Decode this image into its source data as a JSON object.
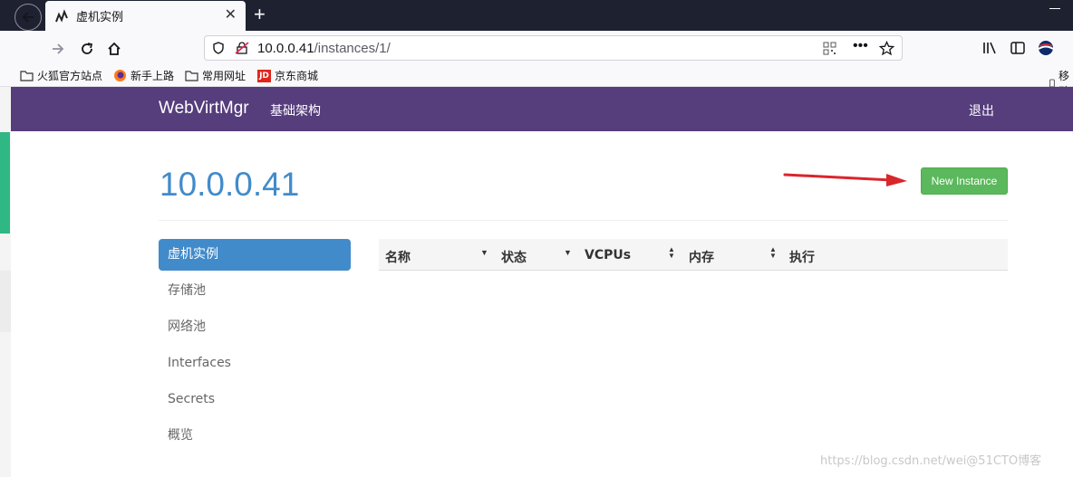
{
  "browser": {
    "tab_title": "虚机实例",
    "tab_close": "✕",
    "new_tab": "+",
    "url_host": "10.0.0.41",
    "url_path": "/instances/1/",
    "bookmarks": [
      "火狐官方站点",
      "新手上路",
      "常用网址",
      "京东商城"
    ],
    "bookmark_mobile": "移动",
    "bookmark_jd_icon_text": "JD"
  },
  "app": {
    "brand": "WebVirtMgr",
    "nav_infrastructure": "基础架构",
    "nav_logout": "退出",
    "page_title": "10.0.0.41",
    "new_instance_button": "New Instance",
    "sidebar": [
      {
        "label": "虚机实例",
        "active": true
      },
      {
        "label": "存储池",
        "active": false
      },
      {
        "label": "网络池",
        "active": false
      },
      {
        "label": "Interfaces",
        "active": false
      },
      {
        "label": "Secrets",
        "active": false
      },
      {
        "label": "概览",
        "active": false
      }
    ],
    "table_headers": [
      "名称",
      "状态",
      "VCPUs",
      "内存",
      "执行"
    ],
    "colors": {
      "header": "#563d7c",
      "accent": "#428bca",
      "success": "#5cb85c",
      "arrow": "#d9262b"
    }
  },
  "watermark": "https://blog.csdn.net/wei@51CTO博客"
}
